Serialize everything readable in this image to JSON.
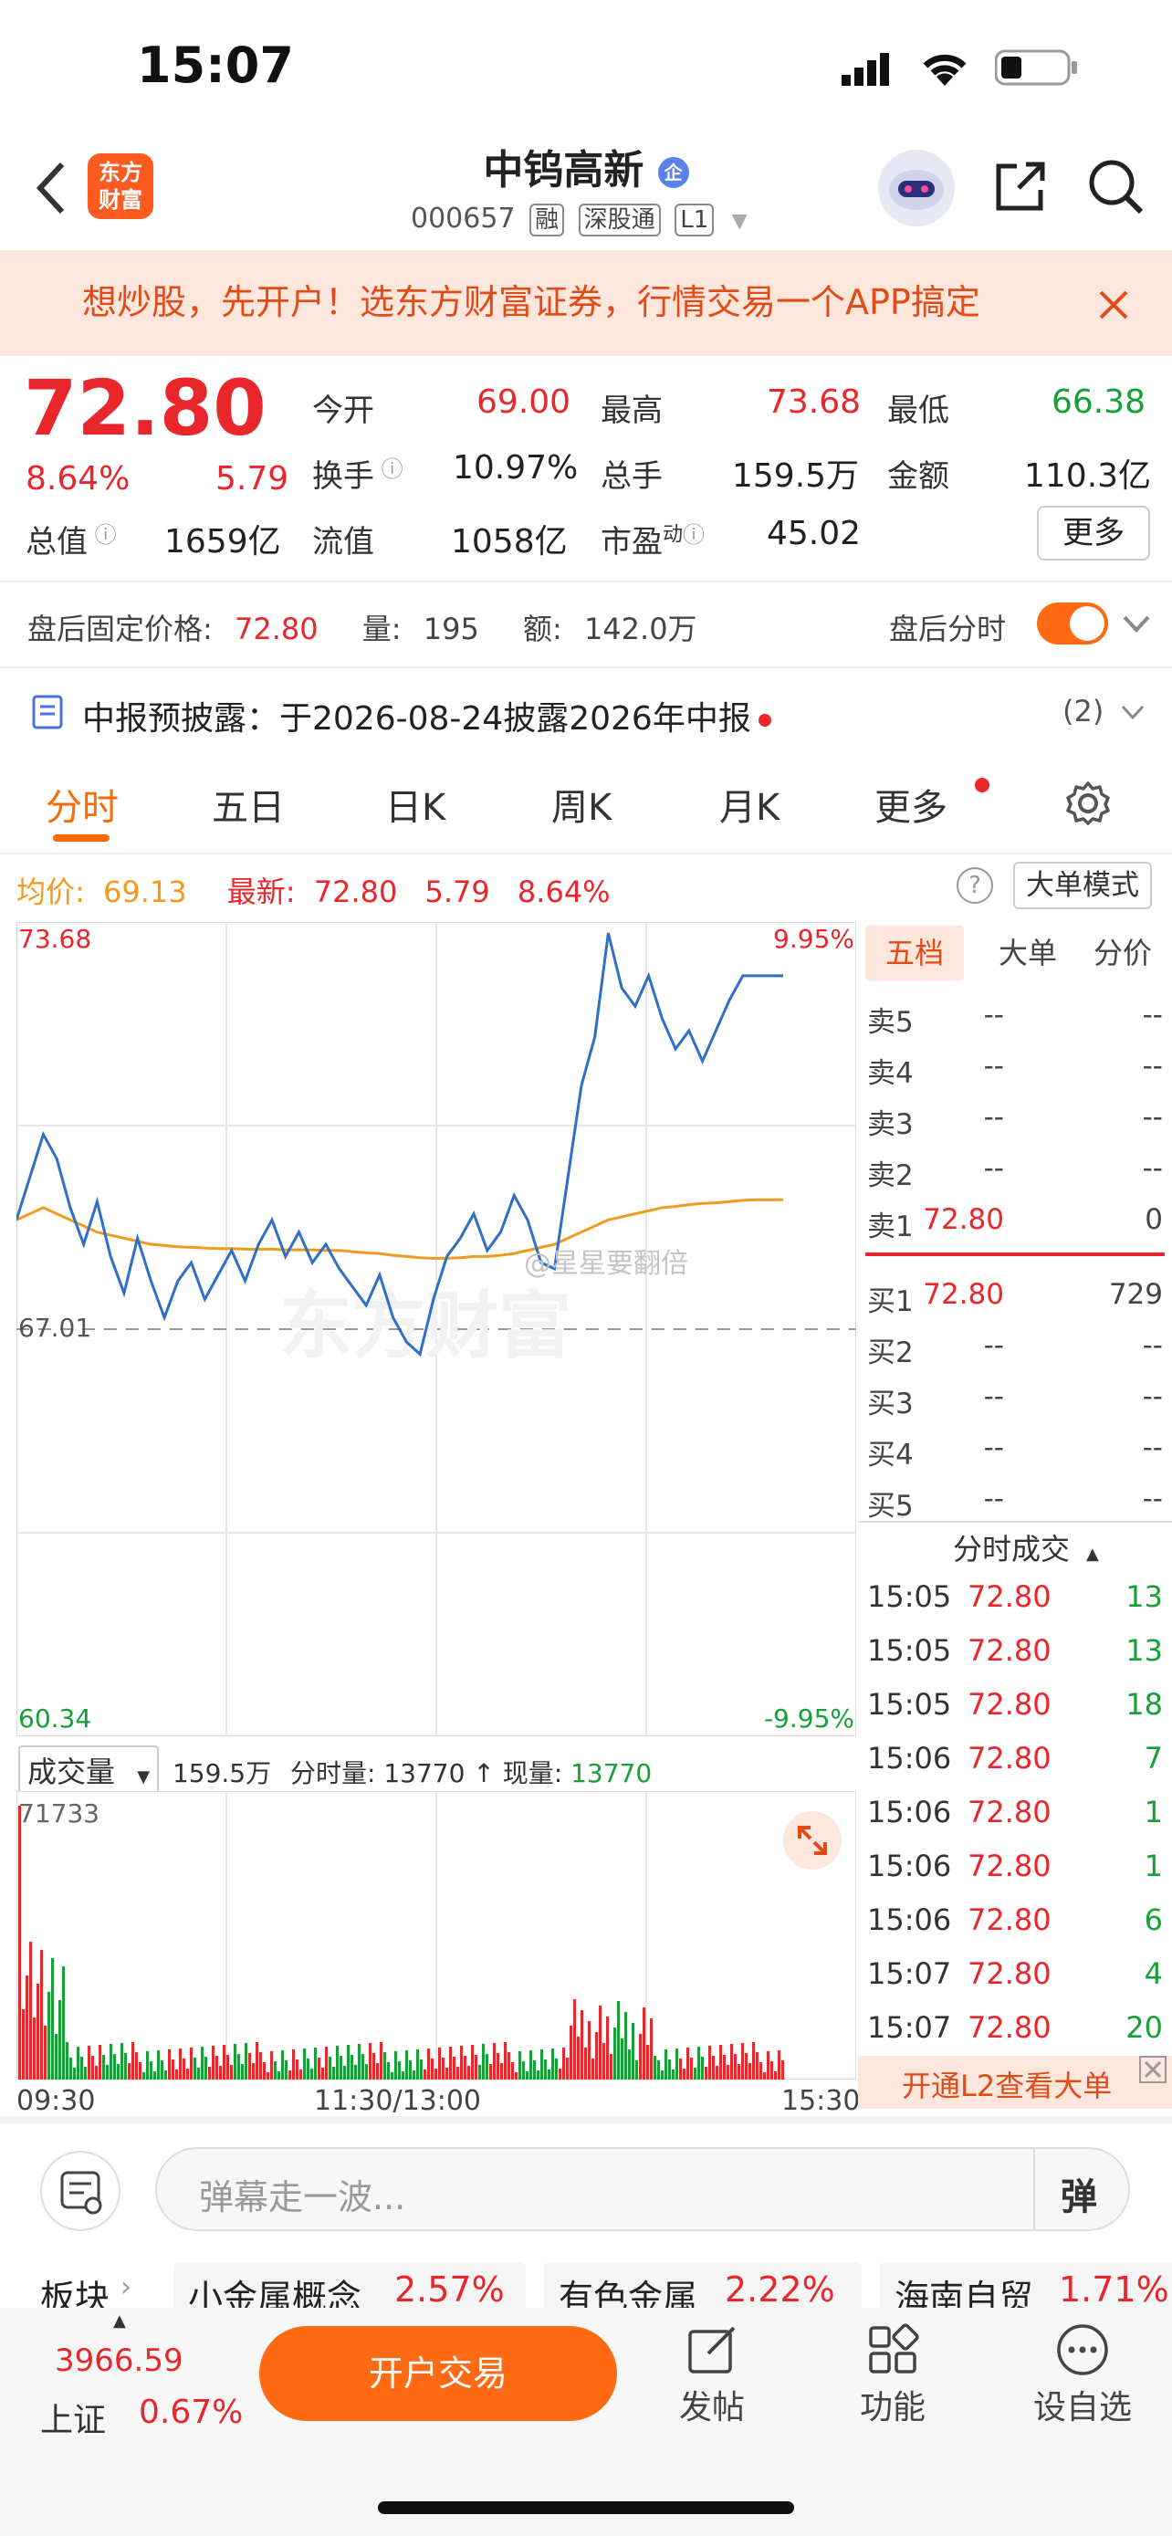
{
  "status": {
    "time": "15:07"
  },
  "header": {
    "brand": "东方财富",
    "stock_name": "中钨高新",
    "stock_code": "000657",
    "tags": [
      "融",
      "深股通",
      "L1"
    ]
  },
  "banner": {
    "text": "想炒股，先开户！选东方财富证券，行情交易一个APP搞定"
  },
  "quote": {
    "price": "72.80",
    "change_pct": "8.64%",
    "change": "5.79",
    "open_label": "今开",
    "open": "69.00",
    "high_label": "最高",
    "high": "73.68",
    "low_label": "最低",
    "low": "66.38",
    "turnover_label": "换手",
    "turnover": "10.97%",
    "volume_label": "总手",
    "volume": "159.5万",
    "amount_label": "金额",
    "amount": "110.3亿",
    "mktcap_label": "总值",
    "mktcap": "1659亿",
    "float_label": "流值",
    "float": "1058亿",
    "pe_label": "市盈",
    "pe_sup": "动",
    "pe": "45.02",
    "more": "更多"
  },
  "after_hours": {
    "price_label": "盘后固定价格:",
    "price": "72.80",
    "vol_label": "量:",
    "vol": "195",
    "amt_label": "额:",
    "amt": "142.0万",
    "toggle_label": "盘后分时"
  },
  "notice": {
    "text": "中报预披露：于2026-08-24披露2026年中报",
    "count": "(2)"
  },
  "tabs": [
    "分时",
    "五日",
    "日K",
    "周K",
    "月K",
    "更多"
  ],
  "chart_info": {
    "avg_label": "均价:",
    "avg": "69.13",
    "latest_label": "最新:",
    "latest": "72.80",
    "change": "5.79",
    "change_pct": "8.64%",
    "mode_button": "大单模式"
  },
  "watermark": "@星星要翻倍",
  "chart_data": {
    "type": "line",
    "title": "",
    "ylim": [
      60.34,
      73.68
    ],
    "y_labels": {
      "top": "73.68",
      "mid": "67.01",
      "bottom": "60.34",
      "top_pct": "9.95%",
      "bottom_pct": "-9.95%"
    },
    "x_labels": [
      "09:30",
      "11:30/13:00",
      "15:30"
    ],
    "series": [
      {
        "name": "最新",
        "color": "#2e6fc7",
        "values": [
          68.8,
          69.5,
          70.2,
          69.8,
          69.0,
          68.4,
          69.1,
          68.2,
          67.6,
          68.5,
          67.8,
          67.2,
          67.8,
          68.1,
          67.5,
          67.9,
          68.3,
          67.8,
          68.4,
          68.8,
          68.2,
          68.6,
          68.1,
          68.4,
          68.0,
          67.7,
          67.4,
          67.9,
          67.2,
          66.8,
          66.6,
          67.5,
          68.2,
          68.5,
          68.9,
          68.3,
          68.6,
          69.2,
          68.8,
          68.1,
          68.0,
          69.5,
          71.0,
          71.8,
          73.5,
          72.6,
          72.3,
          72.8,
          72.1,
          71.6,
          71.9,
          71.4,
          71.9,
          72.4,
          72.8,
          72.8,
          72.8,
          72.8
        ]
      },
      {
        "name": "均价",
        "color": "#f29a1f",
        "values": [
          68.8,
          68.9,
          69.0,
          68.9,
          68.8,
          68.7,
          68.6,
          68.55,
          68.5,
          68.45,
          68.4,
          68.38,
          68.36,
          68.35,
          68.34,
          68.33,
          68.33,
          68.32,
          68.32,
          68.32,
          68.31,
          68.31,
          68.31,
          68.3,
          68.3,
          68.28,
          68.26,
          68.25,
          68.22,
          68.2,
          68.18,
          68.17,
          68.17,
          68.18,
          68.2,
          68.2,
          68.22,
          68.25,
          68.3,
          68.35,
          68.4,
          68.5,
          68.6,
          68.7,
          68.8,
          68.85,
          68.9,
          68.95,
          69.0,
          69.02,
          69.05,
          69.07,
          69.08,
          69.1,
          69.12,
          69.13,
          69.13,
          69.13
        ]
      }
    ],
    "volume": {
      "label": "成交量",
      "total": "159.5万",
      "minute_label": "分时量:",
      "minute": "13770",
      "current_label": "现量:",
      "current": "13770",
      "max": "71733"
    }
  },
  "order_book": {
    "tabs": [
      "五档",
      "大单",
      "分价"
    ],
    "asks": [
      {
        "label": "卖5",
        "price": "--",
        "vol": "--"
      },
      {
        "label": "卖4",
        "price": "--",
        "vol": "--"
      },
      {
        "label": "卖3",
        "price": "--",
        "vol": "--"
      },
      {
        "label": "卖2",
        "price": "--",
        "vol": "--"
      },
      {
        "label": "卖1",
        "price": "72.80",
        "vol": "0"
      }
    ],
    "bids": [
      {
        "label": "买1",
        "price": "72.80",
        "vol": "729"
      },
      {
        "label": "买2",
        "price": "--",
        "vol": "--"
      },
      {
        "label": "买3",
        "price": "--",
        "vol": "--"
      },
      {
        "label": "买4",
        "price": "--",
        "vol": "--"
      },
      {
        "label": "买5",
        "price": "--",
        "vol": "--"
      }
    ]
  },
  "trades": {
    "title": "分时成交",
    "rows": [
      {
        "time": "15:05",
        "price": "72.80",
        "vol": "13"
      },
      {
        "time": "15:05",
        "price": "72.80",
        "vol": "13"
      },
      {
        "time": "15:05",
        "price": "72.80",
        "vol": "18"
      },
      {
        "time": "15:06",
        "price": "72.80",
        "vol": "7"
      },
      {
        "time": "15:06",
        "price": "72.80",
        "vol": "1"
      },
      {
        "time": "15:06",
        "price": "72.80",
        "vol": "1"
      },
      {
        "time": "15:06",
        "price": "72.80",
        "vol": "6"
      },
      {
        "time": "15:07",
        "price": "72.80",
        "vol": "4"
      },
      {
        "time": "15:07",
        "price": "72.80",
        "vol": "20"
      }
    ],
    "l2_prompt": "开通L2查看大单"
  },
  "comment": {
    "placeholder": "弹幕走一波...",
    "danmu": "弹"
  },
  "sectors": {
    "label": "板块",
    "items": [
      {
        "name": "小金属概念",
        "pct": "2.57%"
      },
      {
        "name": "有色金属",
        "pct": "2.22%"
      },
      {
        "name": "海南自贸",
        "pct": "1.71%"
      }
    ]
  },
  "index": {
    "value": "3966.59",
    "name": "上证",
    "pct": "0.67%"
  },
  "bottom_nav": {
    "open_account": "开户交易",
    "post": "发帖",
    "functions": "功能",
    "watchlist": "设自选"
  }
}
